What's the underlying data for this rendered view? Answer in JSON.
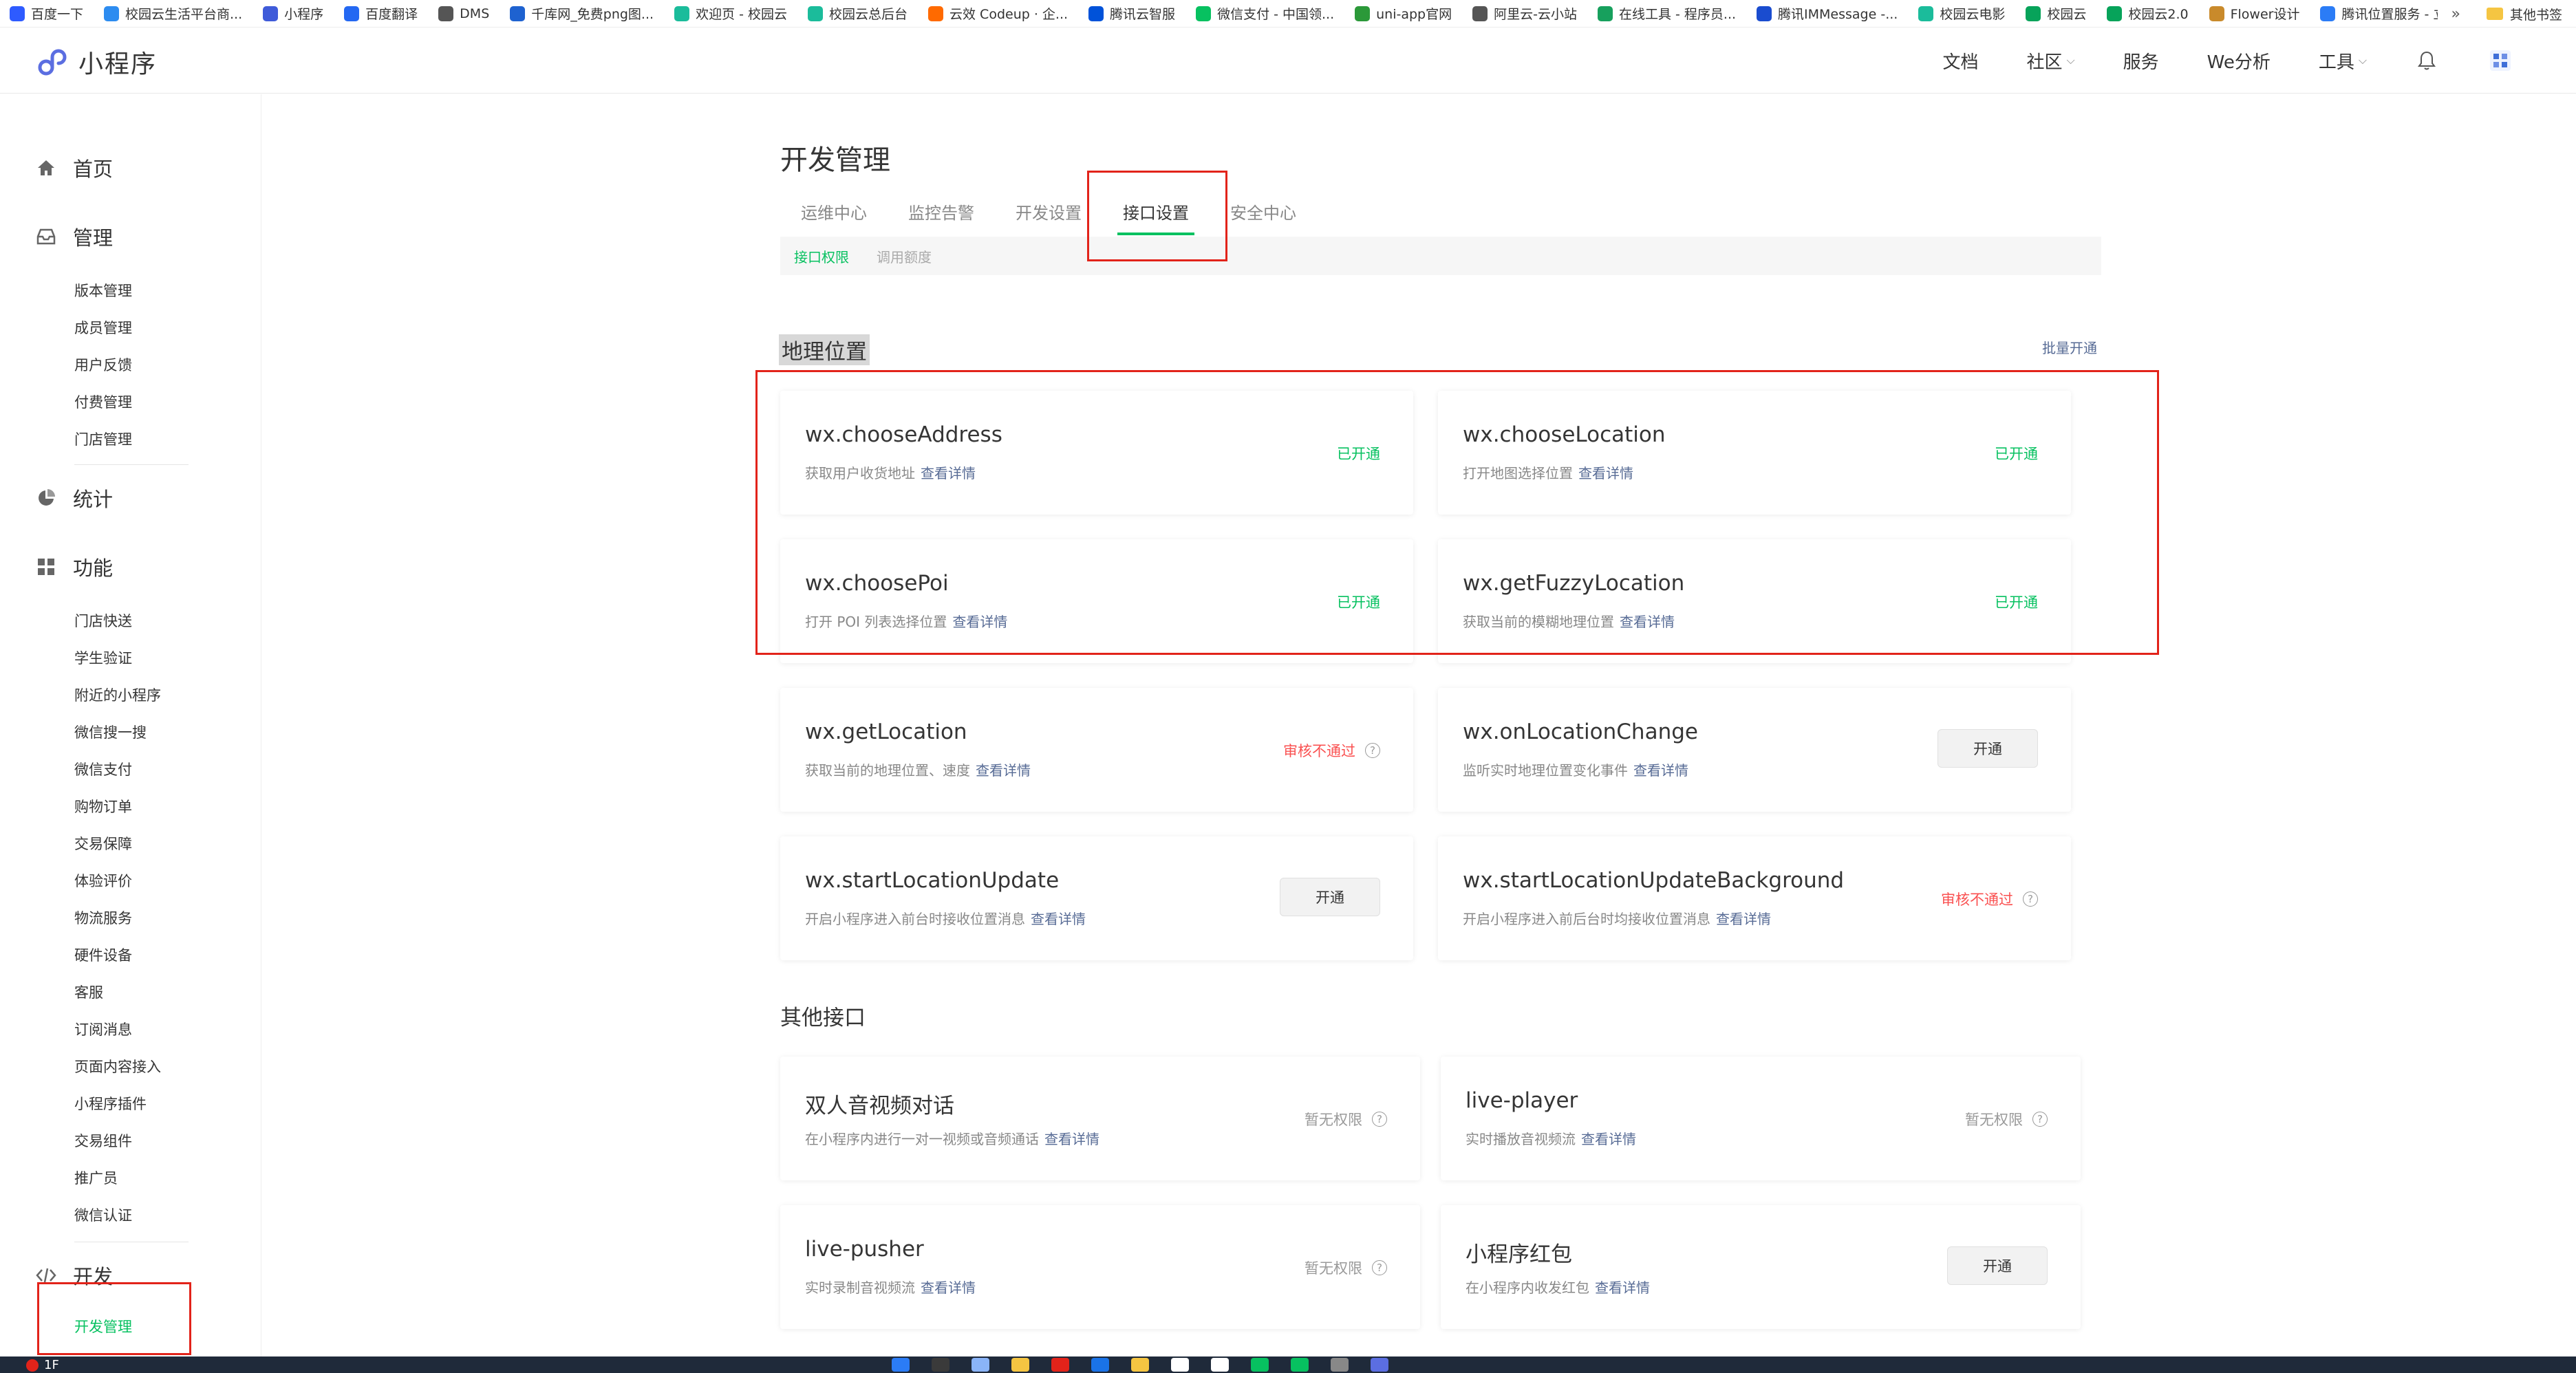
{
  "bookmarks": {
    "items": [
      {
        "label": "百度一下",
        "color": "#2e5bff"
      },
      {
        "label": "校园云生活平台商...",
        "color": "#2d8cf0"
      },
      {
        "label": "小程序",
        "color": "#3f5bd9"
      },
      {
        "label": "百度翻译",
        "color": "#2468f2"
      },
      {
        "label": "DMS",
        "color": "#555555"
      },
      {
        "label": "千库网_免费png图...",
        "color": "#1e62d0"
      },
      {
        "label": "欢迎页 - 校园云",
        "color": "#1bbc9b"
      },
      {
        "label": "校园云总后台",
        "color": "#1bbc9b"
      },
      {
        "label": "云效 Codeup · 企...",
        "color": "#ff6a00"
      },
      {
        "label": "腾讯云智服",
        "color": "#0052d9"
      },
      {
        "label": "微信支付 - 中国领...",
        "color": "#07c160"
      },
      {
        "label": "uni-app官网",
        "color": "#2b9939"
      },
      {
        "label": "阿里云-云小站",
        "color": "#555555"
      },
      {
        "label": "在线工具 - 程序员...",
        "color": "#17a05d"
      },
      {
        "label": "腾讯IMMessage -...",
        "color": "#1a4ccf"
      },
      {
        "label": "校园云电影",
        "color": "#1bbc9b"
      },
      {
        "label": "校园云",
        "color": "#07a35a"
      },
      {
        "label": "校园云2.0",
        "color": "#07a35a"
      },
      {
        "label": "Flower设计",
        "color": "#c98a2b"
      },
      {
        "label": "腾讯位置服务 - 立...",
        "color": "#2b7cf6"
      }
    ],
    "more": "»",
    "folder_label": "其他书签"
  },
  "header": {
    "logo_text": "小程序",
    "nav": [
      {
        "label": "文档",
        "caret": false
      },
      {
        "label": "社区",
        "caret": true
      },
      {
        "label": "服务",
        "caret": false
      },
      {
        "label": "We分析",
        "caret": false
      },
      {
        "label": "工具",
        "caret": true
      }
    ],
    "caret_glyph": "⌵"
  },
  "sidebar": {
    "home": "首页",
    "manage": "管理",
    "manage_items": [
      "版本管理",
      "成员管理",
      "用户反馈",
      "付费管理",
      "门店管理"
    ],
    "stats": "统计",
    "features": "功能",
    "feature_items": [
      "门店快送",
      "学生验证",
      "附近的小程序",
      "微信搜一搜",
      "微信支付",
      "购物订单",
      "交易保障",
      "体验评价",
      "物流服务",
      "硬件设备",
      "客服",
      "订阅消息",
      "页面内容接入",
      "小程序插件",
      "交易组件",
      "推广员",
      "微信认证"
    ],
    "dev": "开发",
    "dev_items": [
      "开发管理"
    ]
  },
  "main": {
    "title": "开发管理",
    "tabs": [
      "运维中心",
      "监控告警",
      "开发设置",
      "接口设置",
      "安全中心"
    ],
    "active_tab": 3,
    "subtabs": [
      "接口权限",
      "调用额度"
    ],
    "active_subtab": 0,
    "geo": {
      "title": "地理位置",
      "batch_label": "批量开通",
      "cards": [
        {
          "name": "wx.chooseAddress",
          "desc": "获取用户收货地址",
          "link": "查看详情",
          "status": "已开通",
          "type": "ok"
        },
        {
          "name": "wx.chooseLocation",
          "desc": "打开地图选择位置",
          "link": "查看详情",
          "status": "已开通",
          "type": "ok"
        },
        {
          "name": "wx.choosePoi",
          "desc": "打开 POI 列表选择位置",
          "link": "查看详情",
          "status": "已开通",
          "type": "ok"
        },
        {
          "name": "wx.getFuzzyLocation",
          "desc": "获取当前的模糊地理位置",
          "link": "查看详情",
          "status": "已开通",
          "type": "ok"
        },
        {
          "name": "wx.getLocation",
          "desc": "获取当前的地理位置、速度",
          "link": "查看详情",
          "status": "审核不通过",
          "type": "fail"
        },
        {
          "name": "wx.onLocationChange",
          "desc": "监听实时地理位置变化事件",
          "link": "查看详情",
          "status": "开通",
          "type": "button"
        },
        {
          "name": "wx.startLocationUpdate",
          "desc": "开启小程序进入前台时接收位置消息",
          "link": "查看详情",
          "status": "开通",
          "type": "button"
        },
        {
          "name": "wx.startLocationUpdateBackground",
          "desc": "开启小程序进入前后台时均接收位置消息",
          "link": "查看详情",
          "status": "审核不通过",
          "type": "fail"
        }
      ]
    },
    "other": {
      "title": "其他接口",
      "cards": [
        {
          "name": "双人音视频对话",
          "desc": "在小程序内进行一对一视频或音频通话",
          "link": "查看详情",
          "status": "暂无权限",
          "type": "none"
        },
        {
          "name": "live-player",
          "desc": "实时播放音视频流",
          "link": "查看详情",
          "status": "暂无权限",
          "type": "none"
        },
        {
          "name": "live-pusher",
          "desc": "实时录制音视频流",
          "link": "查看详情",
          "status": "暂无权限",
          "type": "none"
        },
        {
          "name": "小程序红包",
          "desc": "在小程序内收发红包",
          "link": "查看详情",
          "status": "开通",
          "type": "button"
        }
      ]
    }
  },
  "taskbar": {
    "left_text": "1F",
    "app_colors": [
      "#2b7cf6",
      "#3a3a3a",
      "#8ab4f8",
      "#f5c542",
      "#e2231a",
      "#1a73e8",
      "#f5c542",
      "#ffffff",
      "#ffffff",
      "#07c160",
      "#07c160",
      "#888888",
      "#5b6ee1"
    ]
  },
  "colors": {
    "accent": "#07c160",
    "link": "#576b95",
    "danger": "#fa5151",
    "annotation": "#e2231a"
  }
}
